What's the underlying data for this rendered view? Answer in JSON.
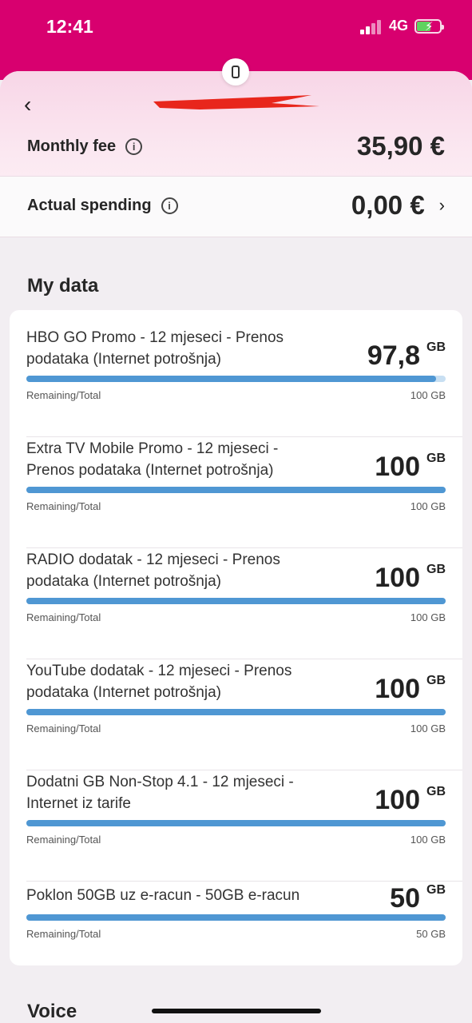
{
  "status": {
    "time": "12:41",
    "network": "4G"
  },
  "header": {
    "fee_label": "Monthly fee",
    "fee_value": "35,90 €",
    "spend_label": "Actual spending",
    "spend_value": "0,00 €"
  },
  "data_section": {
    "title": "My data",
    "remaining_label": "Remaining/Total",
    "items": [
      {
        "title": "HBO GO Promo - 12 mjeseci - Prenos podataka (Internet potrošnja)",
        "amount": "97,8",
        "unit": "GB",
        "total": "100 GB",
        "fraction": 0.978
      },
      {
        "title": "Extra TV Mobile Promo - 12 mjeseci - Prenos podataka (Internet potrošnja)",
        "amount": "100",
        "unit": "GB",
        "total": "100 GB",
        "fraction": 1.0
      },
      {
        "title": "RADIO dodatak - 12 mjeseci - Prenos podataka (Internet potrošnja)",
        "amount": "100",
        "unit": "GB",
        "total": "100 GB",
        "fraction": 1.0
      },
      {
        "title": "YouTube dodatak - 12 mjeseci - Prenos podataka (Internet potrošnja)",
        "amount": "100",
        "unit": "GB",
        "total": "100 GB",
        "fraction": 1.0
      },
      {
        "title": "Dodatni GB Non-Stop 4.1 - 12 mjeseci - Internet iz tarife",
        "amount": "100",
        "unit": "GB",
        "total": "100 GB",
        "fraction": 1.0
      },
      {
        "title": "Poklon 50GB uz e-racun - 50GB e-racun",
        "amount": "50",
        "unit": "GB",
        "total": "50 GB",
        "fraction": 1.0
      }
    ]
  },
  "voice_section": {
    "title": "Voice"
  },
  "colors": {
    "brand": "#d8006f",
    "bar": "#4f97d3",
    "bar_track": "#c8dff2"
  }
}
